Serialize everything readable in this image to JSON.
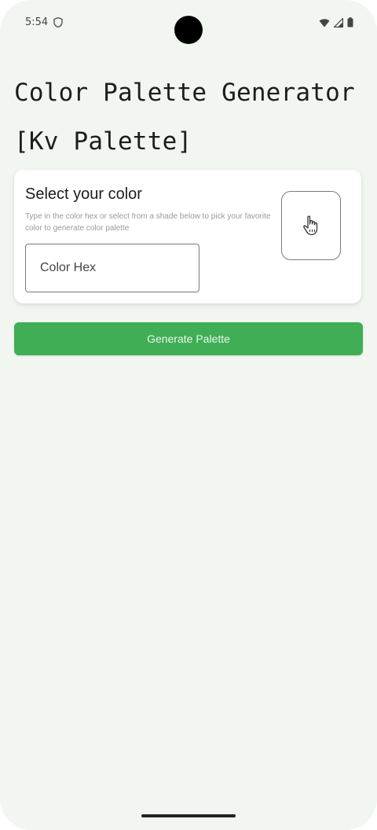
{
  "status_bar": {
    "time": "5:54",
    "shield_icon": "shield-icon",
    "wifi_icon": "wifi-icon",
    "signal_icon": "signal-icon",
    "battery_icon": "battery-icon"
  },
  "header": {
    "title_line1": "Color Palette Generator",
    "title_line2": "[Kv Palette]"
  },
  "card": {
    "title": "Select your color",
    "description": "Type in the color hex or select from a shade below to pick your favorite color to generate color palette",
    "hex_input": {
      "placeholder": "Color Hex",
      "value": ""
    },
    "picker_icon": "pointing-hand-icon"
  },
  "actions": {
    "generate_label": "Generate Palette"
  },
  "colors": {
    "background": "#f2f6f0",
    "card": "#ffffff",
    "accent_green": "#3fae55",
    "title_text": "#1d1d1d"
  }
}
